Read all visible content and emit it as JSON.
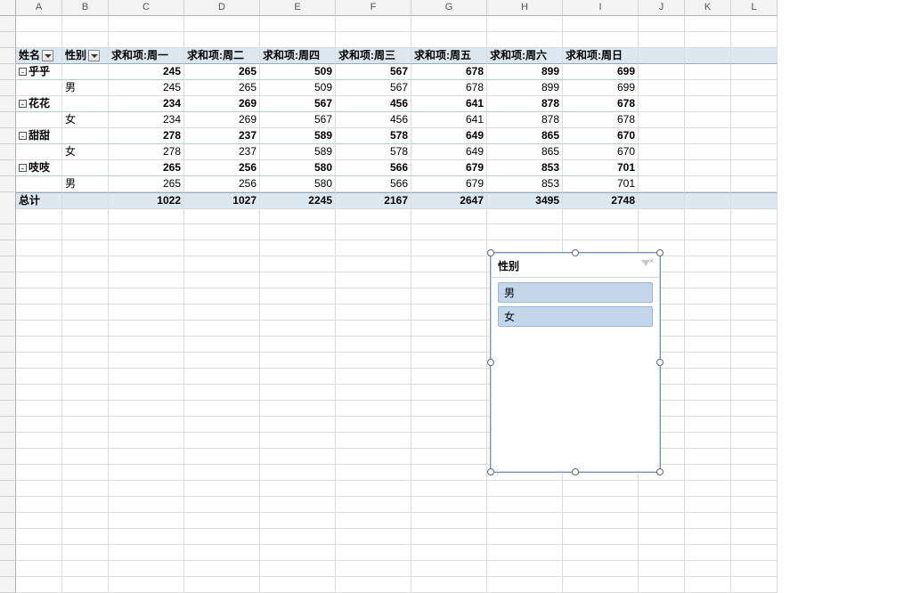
{
  "columns": [
    "A",
    "B",
    "C",
    "D",
    "E",
    "F",
    "G",
    "H",
    "I",
    "J",
    "K",
    "L"
  ],
  "pivot": {
    "row_field_label": "姓名",
    "col_field_label": "性别",
    "value_headers": [
      "求和项:周一",
      "求和项:周二",
      "求和项:周四",
      "求和项:周三",
      "求和项:周五",
      "求和项:周六",
      "求和项:周日"
    ],
    "groups": [
      {
        "name": "乎乎",
        "totals": [
          245,
          265,
          509,
          567,
          678,
          899,
          699
        ],
        "rows": [
          {
            "gender": "男",
            "values": [
              245,
              265,
              509,
              567,
              678,
              899,
              699
            ]
          }
        ]
      },
      {
        "name": "花花",
        "totals": [
          234,
          269,
          567,
          456,
          641,
          878,
          678
        ],
        "rows": [
          {
            "gender": "女",
            "values": [
              234,
              269,
              567,
              456,
              641,
              878,
              678
            ]
          }
        ]
      },
      {
        "name": "甜甜",
        "totals": [
          278,
          237,
          589,
          578,
          649,
          865,
          670
        ],
        "rows": [
          {
            "gender": "女",
            "values": [
              278,
              237,
              589,
              578,
              649,
              865,
              670
            ]
          }
        ]
      },
      {
        "name": "吱吱",
        "totals": [
          265,
          256,
          580,
          566,
          679,
          853,
          701
        ],
        "rows": [
          {
            "gender": "男",
            "values": [
              265,
              256,
              580,
              566,
              679,
              853,
              701
            ]
          }
        ]
      }
    ],
    "grand_label": "总计",
    "grand_totals": [
      1022,
      1027,
      2245,
      2167,
      2647,
      3495,
      2748
    ]
  },
  "slicer": {
    "title": "性别",
    "items": [
      "男",
      "女"
    ]
  },
  "collapse_glyph": "⊟"
}
